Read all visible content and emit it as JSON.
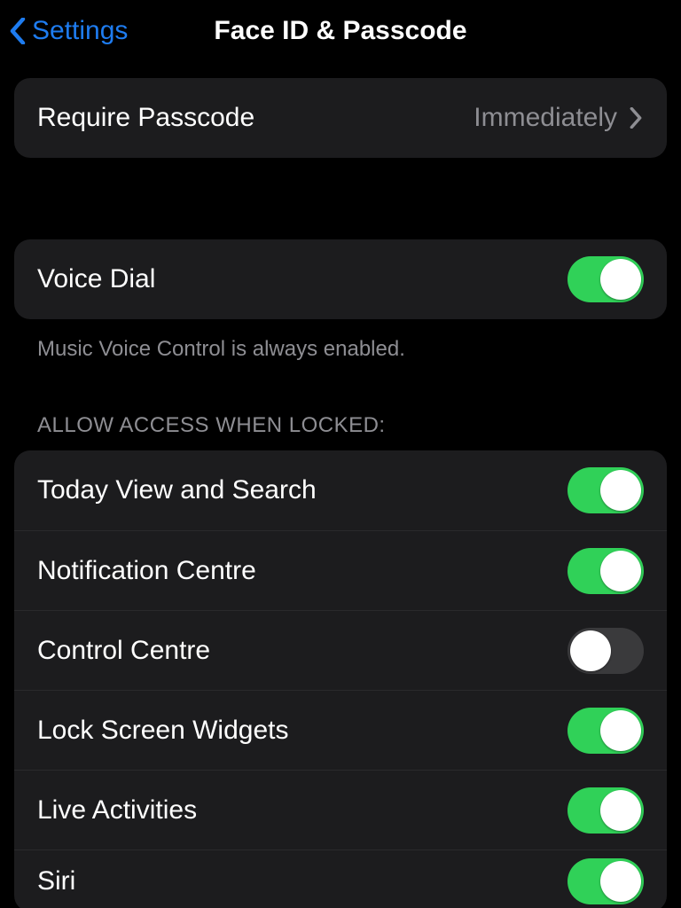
{
  "nav": {
    "back_label": "Settings",
    "title": "Face ID & Passcode"
  },
  "require_passcode": {
    "label": "Require Passcode",
    "value": "Immediately"
  },
  "voice_dial": {
    "label": "Voice Dial",
    "on": true,
    "footer": "Music Voice Control is always enabled."
  },
  "allow_access": {
    "header": "ALLOW ACCESS WHEN LOCKED:",
    "items": [
      {
        "label": "Today View and Search",
        "on": true
      },
      {
        "label": "Notification Centre",
        "on": true
      },
      {
        "label": "Control Centre",
        "on": false
      },
      {
        "label": "Lock Screen Widgets",
        "on": true
      },
      {
        "label": "Live Activities",
        "on": true
      },
      {
        "label": "Siri",
        "on": true
      }
    ]
  }
}
